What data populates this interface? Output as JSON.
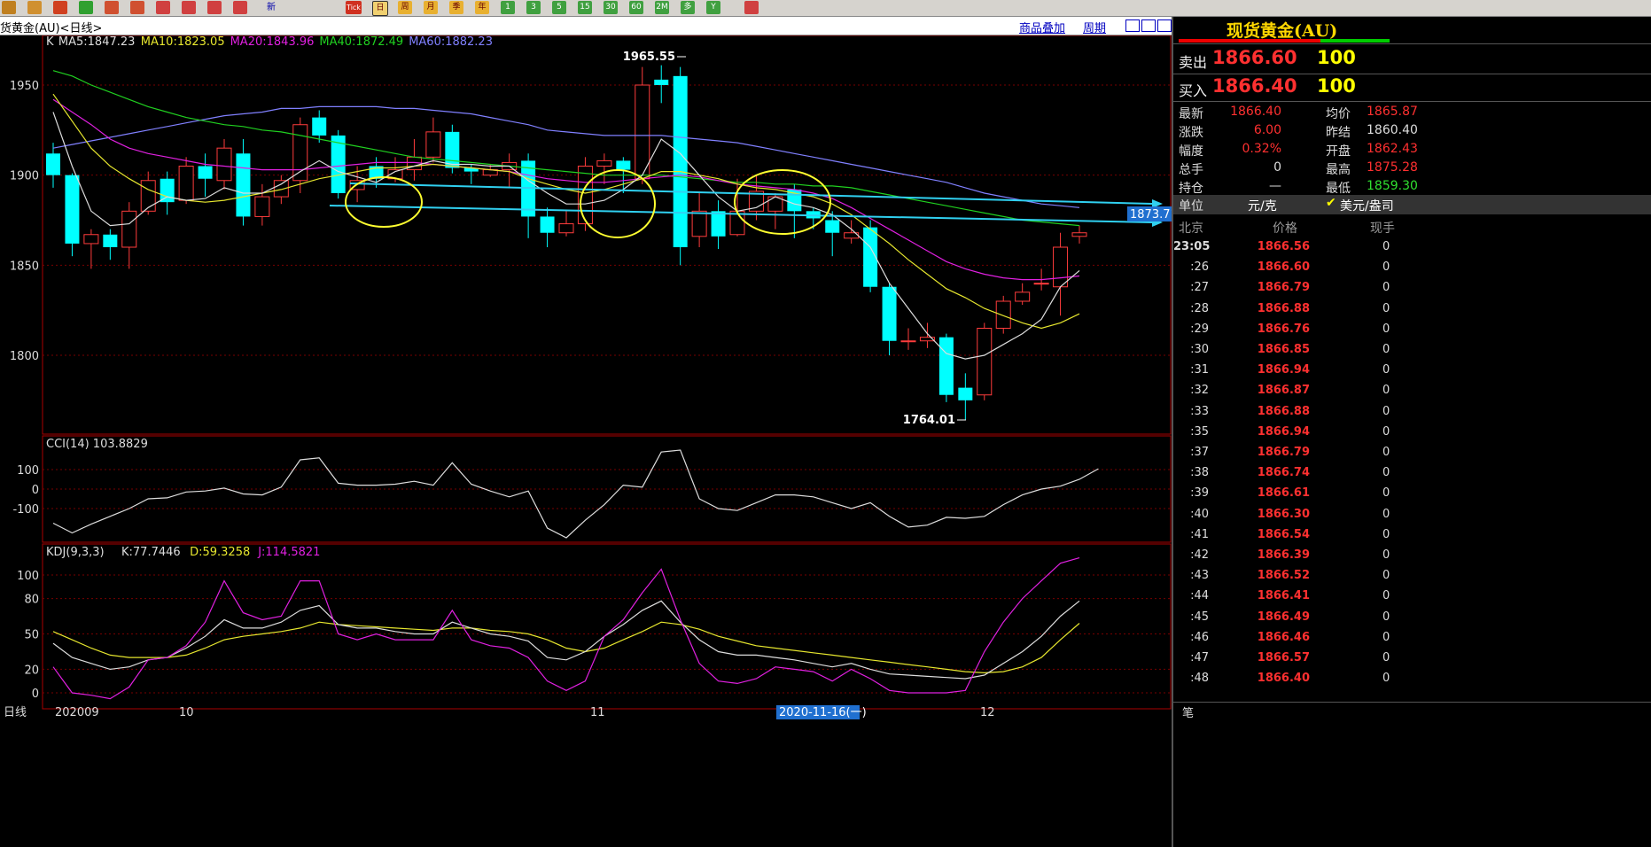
{
  "toolbar": {
    "tools": [
      {
        "icon": "home-icon",
        "color": "#c08020"
      },
      {
        "icon": "db-icon",
        "color": "#d09030"
      },
      {
        "icon": "chart-icon",
        "color": "#d04020"
      },
      {
        "icon": "refresh-icon",
        "color": "#30a030"
      },
      {
        "icon": "zoom-in-icon",
        "color": "#d05030"
      },
      {
        "icon": "zoom-out-icon",
        "color": "#d05030"
      },
      {
        "icon": "copy-icon",
        "color": "#d04040"
      },
      {
        "icon": "pen-icon",
        "color": "#d04040"
      },
      {
        "icon": "brush-icon",
        "color": "#d04040"
      },
      {
        "icon": "pin-icon",
        "color": "#d04040"
      }
    ],
    "new_label": "新",
    "tick_label": "Tick",
    "periods": [
      "日",
      "周",
      "月",
      "季",
      "年",
      "1",
      "3",
      "5",
      "15",
      "30",
      "60",
      "2M",
      "多",
      "Y"
    ]
  },
  "titlebar": {
    "title": "货黄金(AU)<日线>",
    "overlay": "商品叠加",
    "period": "周期"
  },
  "indicators": {
    "ma": [
      {
        "label": "K",
        "color": "#dddddd"
      },
      {
        "label": "MA5:1847.23",
        "color": "#dddddd"
      },
      {
        "label": "MA10:1823.05",
        "color": "#e6e62e"
      },
      {
        "label": "MA20:1843.96",
        "color": "#e020e0"
      },
      {
        "label": "MA40:1872.49",
        "color": "#20d020"
      },
      {
        "label": "MA60:1882.23",
        "color": "#8080ff"
      }
    ],
    "cci": {
      "label": "CCI(14) 103.8829",
      "color": "#dddddd"
    },
    "kdj": [
      {
        "label": "KDJ(9,3,3)",
        "color": "#dddddd"
      },
      {
        "label": "K:77.7446",
        "color": "#dddddd"
      },
      {
        "label": "D:59.3258",
        "color": "#e6e62e"
      },
      {
        "label": "J:114.5821",
        "color": "#e020e0"
      }
    ]
  },
  "axis": {
    "price_ticks": [
      "1950",
      "1900",
      "1850",
      "1800"
    ],
    "cci_ticks": [
      "100",
      "0",
      "-100"
    ],
    "kdj_ticks": [
      "100",
      "80",
      "50",
      "20",
      "0"
    ],
    "x_ticks": [
      "日线",
      "202009",
      "10",
      "11",
      "2020-11-16(一)",
      "12"
    ]
  },
  "annotations": {
    "high": "1965.55",
    "low": "1764.01",
    "trend_price": "1873.71"
  },
  "chart_data": {
    "type": "candlestick",
    "ylim": [
      1755,
      1980
    ],
    "candles": [
      [
        1912,
        1900,
        1918,
        1893
      ],
      [
        1900,
        1862,
        1901,
        1855
      ],
      [
        1862,
        1867,
        1870,
        1848
      ],
      [
        1867,
        1860,
        1870,
        1853
      ],
      [
        1860,
        1880,
        1885,
        1848
      ],
      [
        1880,
        1897,
        1902,
        1878
      ],
      [
        1898,
        1885,
        1902,
        1878
      ],
      [
        1886,
        1905,
        1910,
        1884
      ],
      [
        1905,
        1898,
        1912,
        1888
      ],
      [
        1897,
        1915,
        1920,
        1892
      ],
      [
        1912,
        1877,
        1920,
        1872
      ],
      [
        1877,
        1888,
        1895,
        1872
      ],
      [
        1888,
        1897,
        1900,
        1884
      ],
      [
        1897,
        1928,
        1932,
        1890
      ],
      [
        1932,
        1922,
        1936,
        1918
      ],
      [
        1922,
        1890,
        1925,
        1887
      ],
      [
        1892,
        1897,
        1905,
        1885
      ],
      [
        1905,
        1898,
        1910,
        1893
      ],
      [
        1898,
        1903,
        1910,
        1896
      ],
      [
        1903,
        1910,
        1920,
        1897
      ],
      [
        1910,
        1924,
        1932,
        1907
      ],
      [
        1924,
        1904,
        1928,
        1901
      ],
      [
        1904,
        1902,
        1906,
        1895
      ],
      [
        1900,
        1903,
        1906,
        1899
      ],
      [
        1903,
        1907,
        1912,
        1893
      ],
      [
        1908,
        1877,
        1912,
        1865
      ],
      [
        1877,
        1868,
        1882,
        1860
      ],
      [
        1868,
        1873,
        1880,
        1866
      ],
      [
        1873,
        1905,
        1910,
        1869
      ],
      [
        1905,
        1908,
        1912,
        1895
      ],
      [
        1908,
        1903,
        1910,
        1890
      ],
      [
        1898,
        1950,
        1960,
        1895
      ],
      [
        1953,
        1950,
        1961,
        1940
      ],
      [
        1955,
        1860,
        1960,
        1850
      ],
      [
        1866,
        1880,
        1890,
        1860
      ],
      [
        1880,
        1866,
        1886,
        1859
      ],
      [
        1867,
        1880,
        1898,
        1866
      ],
      [
        1880,
        1891,
        1900,
        1875
      ],
      [
        1880,
        1888,
        1890,
        1870
      ],
      [
        1892,
        1880,
        1895,
        1865
      ],
      [
        1880,
        1876,
        1882,
        1870
      ],
      [
        1875,
        1868,
        1880,
        1855
      ],
      [
        1865,
        1868,
        1875,
        1862
      ],
      [
        1871,
        1838,
        1875,
        1835
      ],
      [
        1838,
        1808,
        1840,
        1800
      ],
      [
        1808,
        1808,
        1815,
        1803
      ],
      [
        1808,
        1810,
        1818,
        1804
      ],
      [
        1810,
        1778,
        1812,
        1774
      ],
      [
        1782,
        1775,
        1790,
        1764
      ],
      [
        1778,
        1815,
        1818,
        1775
      ],
      [
        1815,
        1830,
        1833,
        1812
      ],
      [
        1830,
        1835,
        1840,
        1828
      ],
      [
        1840,
        1840,
        1848,
        1836
      ],
      [
        1838,
        1860,
        1868,
        1822
      ],
      [
        1866,
        1868,
        1872,
        1862
      ]
    ],
    "ma5": [
      1935,
      1905,
      1880,
      1872,
      1873,
      1882,
      1888,
      1886,
      1887,
      1893,
      1890,
      1890,
      1895,
      1902,
      1908,
      1902,
      1899,
      1896,
      1902,
      1905,
      1908,
      1906,
      1906,
      1905,
      1905,
      1897,
      1890,
      1884,
      1884,
      1886,
      1892,
      1900,
      1920,
      1912,
      1900,
      1888,
      1880,
      1882,
      1888,
      1884,
      1882,
      1878,
      1870,
      1860,
      1840,
      1826,
      1812,
      1801,
      1798,
      1800,
      1806,
      1812,
      1820,
      1838,
      1847
    ],
    "ma10": [
      1945,
      1930,
      1915,
      1905,
      1898,
      1892,
      1888,
      1886,
      1885,
      1886,
      1888,
      1890,
      1892,
      1895,
      1898,
      1900,
      1902,
      1904,
      1904,
      1905,
      1906,
      1905,
      1904,
      1903,
      1902,
      1898,
      1895,
      1892,
      1890,
      1892,
      1895,
      1898,
      1902,
      1902,
      1900,
      1898,
      1895,
      1893,
      1892,
      1890,
      1888,
      1884,
      1878,
      1870,
      1862,
      1853,
      1845,
      1837,
      1832,
      1826,
      1822,
      1818,
      1815,
      1818,
      1823
    ],
    "ma20": [
      1942,
      1935,
      1928,
      1920,
      1915,
      1912,
      1910,
      1908,
      1906,
      1905,
      1904,
      1903,
      1903,
      1903,
      1904,
      1905,
      1906,
      1907,
      1907,
      1907,
      1906,
      1905,
      1904,
      1903,
      1902,
      1900,
      1898,
      1897,
      1896,
      1896,
      1897,
      1898,
      1899,
      1900,
      1899,
      1897,
      1895,
      1894,
      1893,
      1892,
      1890,
      1887,
      1882,
      1876,
      1870,
      1864,
      1858,
      1852,
      1848,
      1845,
      1843,
      1842,
      1842,
      1843,
      1844
    ],
    "ma40": [
      1958,
      1955,
      1950,
      1946,
      1942,
      1938,
      1935,
      1932,
      1930,
      1928,
      1927,
      1925,
      1924,
      1922,
      1920,
      1918,
      1916,
      1914,
      1912,
      1910,
      1909,
      1908,
      1907,
      1906,
      1905,
      1904,
      1903,
      1902,
      1901,
      1900,
      1900,
      1900,
      1900,
      1899,
      1898,
      1897,
      1896,
      1896,
      1895,
      1895,
      1894,
      1894,
      1893,
      1891,
      1889,
      1887,
      1885,
      1883,
      1881,
      1879,
      1877,
      1875,
      1874,
      1873,
      1872
    ],
    "ma60": [
      1915,
      1917,
      1919,
      1921,
      1923,
      1925,
      1927,
      1929,
      1931,
      1933,
      1934,
      1935,
      1937,
      1937,
      1938,
      1938,
      1938,
      1938,
      1937,
      1937,
      1936,
      1935,
      1934,
      1932,
      1930,
      1928,
      1925,
      1924,
      1923,
      1922,
      1922,
      1922,
      1922,
      1921,
      1920,
      1919,
      1918,
      1916,
      1914,
      1912,
      1910,
      1908,
      1906,
      1904,
      1902,
      1900,
      1898,
      1896,
      1893,
      1890,
      1888,
      1886,
      1884,
      1883,
      1882
    ],
    "cci": [
      -175,
      -225,
      -180,
      -140,
      -100,
      -50,
      -45,
      -15,
      -10,
      5,
      -25,
      -30,
      10,
      150,
      160,
      30,
      20,
      20,
      25,
      40,
      20,
      135,
      25,
      -10,
      -40,
      -10,
      -200,
      -250,
      -160,
      -80,
      20,
      10,
      190,
      200,
      -50,
      -100,
      -110,
      -70,
      -30,
      -30,
      -40,
      -70,
      -100,
      -70,
      -140,
      -195,
      -185,
      -145,
      -150,
      -140,
      -80,
      -30,
      0,
      15,
      50,
      104
    ],
    "kdj_k": [
      42,
      30,
      25,
      20,
      22,
      28,
      30,
      38,
      48,
      62,
      55,
      55,
      60,
      70,
      74,
      58,
      55,
      55,
      52,
      50,
      50,
      60,
      55,
      50,
      48,
      44,
      30,
      28,
      35,
      48,
      58,
      70,
      78,
      60,
      45,
      35,
      32,
      32,
      30,
      28,
      25,
      22,
      25,
      20,
      16,
      15,
      14,
      13,
      12,
      15,
      25,
      35,
      48,
      65,
      78
    ],
    "kdj_d": [
      52,
      45,
      38,
      32,
      30,
      30,
      30,
      32,
      38,
      45,
      48,
      50,
      52,
      55,
      60,
      58,
      57,
      56,
      55,
      54,
      53,
      55,
      55,
      53,
      52,
      50,
      45,
      38,
      35,
      38,
      45,
      52,
      60,
      58,
      54,
      48,
      44,
      40,
      38,
      36,
      34,
      32,
      30,
      28,
      26,
      24,
      22,
      20,
      18,
      17,
      18,
      22,
      30,
      45,
      59
    ],
    "kdj_j": [
      22,
      0,
      -2,
      -5,
      5,
      28,
      30,
      40,
      60,
      95,
      68,
      62,
      65,
      95,
      95,
      50,
      45,
      50,
      45,
      45,
      45,
      70,
      45,
      40,
      38,
      30,
      10,
      2,
      10,
      48,
      62,
      85,
      105,
      62,
      25,
      10,
      8,
      12,
      22,
      20,
      18,
      10,
      20,
      12,
      2,
      0,
      0,
      0,
      2,
      35,
      60,
      80,
      95,
      110,
      114.58
    ]
  },
  "right_panel": {
    "title": "现货黄金(AU)",
    "sell": {
      "label": "卖出",
      "price": "1866.60",
      "vol": "100"
    },
    "buy": {
      "label": "买入",
      "price": "1866.40",
      "vol": "100"
    },
    "stats": [
      {
        "l1": "最新",
        "v1": "1866.40",
        "c1": "#ff3030",
        "l2": "均价",
        "v2": "1865.87",
        "c2": "#ff3030"
      },
      {
        "l1": "涨跌",
        "v1": "6.00",
        "c1": "#ff3030",
        "l2": "昨结",
        "v2": "1860.40",
        "c2": "#dddddd"
      },
      {
        "l1": "幅度",
        "v1": "0.32%",
        "c1": "#ff3030",
        "l2": "开盘",
        "v2": "1862.43",
        "c2": "#ff3030"
      },
      {
        "l1": "总手",
        "v1": "0",
        "c1": "#dddddd",
        "l2": "最高",
        "v2": "1875.28",
        "c2": "#ff3030"
      },
      {
        "l1": "持仓",
        "v1": "—",
        "c1": "#dddddd",
        "l2": "最低",
        "v2": "1859.30",
        "c2": "#30e030"
      }
    ],
    "unit": {
      "label": "单位",
      "value": "元/克",
      "option": "美元/盎司"
    },
    "tick_header": {
      "place": "北京",
      "price": "价格",
      "vol": "现手"
    },
    "ticks": [
      {
        "t": "23:05",
        "p": "1866.56"
      },
      {
        "t": ":26",
        "p": "1866.60"
      },
      {
        "t": ":27",
        "p": "1866.79"
      },
      {
        "t": ":28",
        "p": "1866.88"
      },
      {
        "t": ":29",
        "p": "1866.76"
      },
      {
        "t": ":30",
        "p": "1866.85"
      },
      {
        "t": ":31",
        "p": "1866.94"
      },
      {
        "t": ":32",
        "p": "1866.87"
      },
      {
        "t": ":33",
        "p": "1866.88"
      },
      {
        "t": ":35",
        "p": "1866.94"
      },
      {
        "t": ":37",
        "p": "1866.79"
      },
      {
        "t": ":38",
        "p": "1866.74"
      },
      {
        "t": ":39",
        "p": "1866.61"
      },
      {
        "t": ":40",
        "p": "1866.30"
      },
      {
        "t": ":41",
        "p": "1866.54"
      },
      {
        "t": ":42",
        "p": "1866.39"
      },
      {
        "t": ":43",
        "p": "1866.52"
      },
      {
        "t": ":44",
        "p": "1866.41"
      },
      {
        "t": ":45",
        "p": "1866.49"
      },
      {
        "t": ":46",
        "p": "1866.46"
      },
      {
        "t": ":47",
        "p": "1866.57"
      },
      {
        "t": ":48",
        "p": "1866.40"
      }
    ],
    "footer": "笔"
  }
}
